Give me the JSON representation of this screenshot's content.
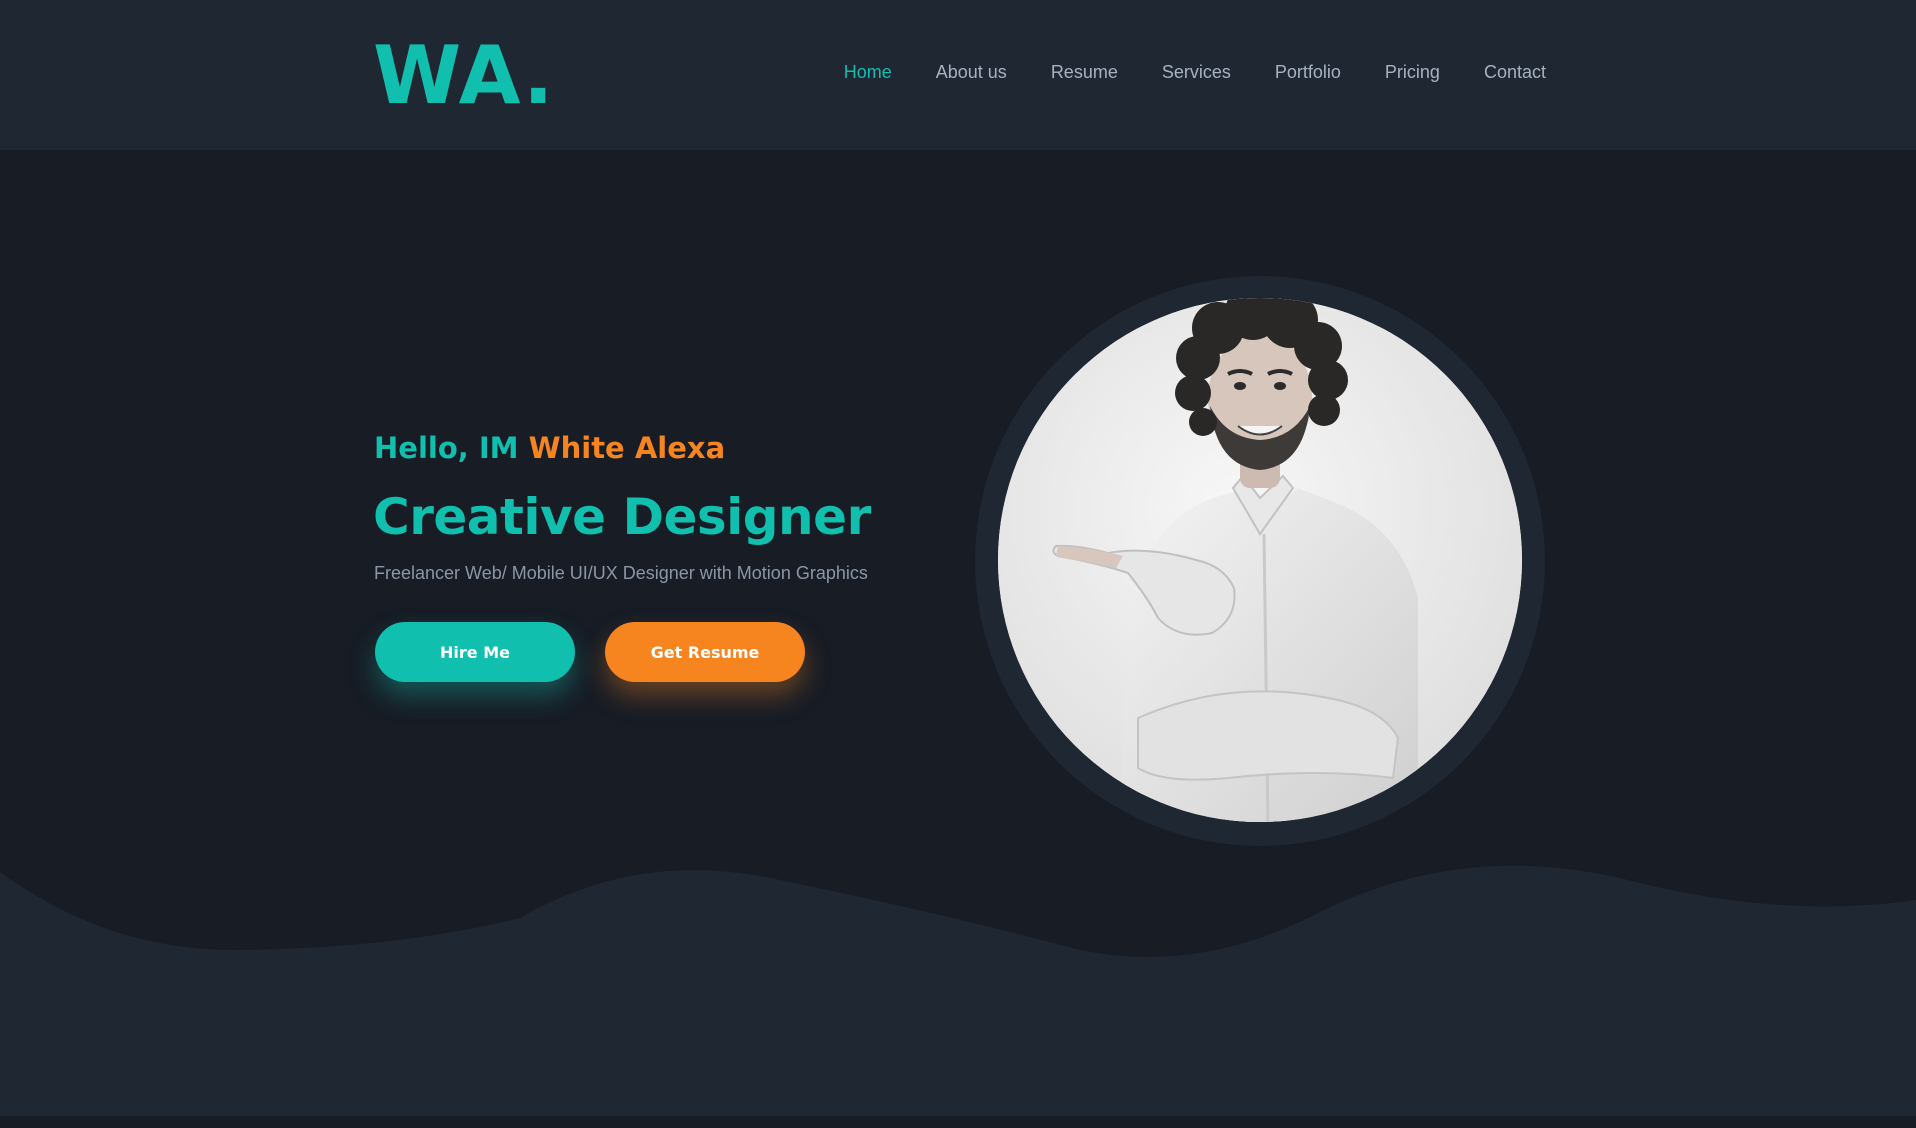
{
  "brand": {
    "logo_text": "WA.",
    "accent": "#11bfae",
    "secondary": "#f6851f"
  },
  "nav": {
    "items": [
      {
        "label": "Home",
        "active": true
      },
      {
        "label": "About us",
        "active": false
      },
      {
        "label": "Resume",
        "active": false
      },
      {
        "label": "Services",
        "active": false
      },
      {
        "label": "Portfolio",
        "active": false
      },
      {
        "label": "Pricing",
        "active": false
      },
      {
        "label": "Contact",
        "active": false
      }
    ]
  },
  "hero": {
    "greeting_prefix": "Hello, IM",
    "name": "White Alexa",
    "title": "Creative Designer",
    "subtitle": "Freelancer Web/ Mobile UI/UX Designer with Motion Graphics",
    "buttons": {
      "hire": "Hire Me",
      "resume": "Get Resume"
    },
    "portrait_icon": "person-portrait-icon"
  },
  "colors": {
    "background": "#171c25",
    "navbar": "#1f2733",
    "text_muted": "#8b96a7"
  }
}
